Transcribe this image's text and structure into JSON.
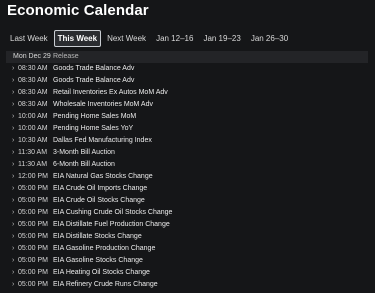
{
  "page": {
    "title": "Economic Calendar"
  },
  "tabs": [
    {
      "label": "Last Week",
      "active": false
    },
    {
      "label": "This Week",
      "active": true
    },
    {
      "label": "Next Week",
      "active": false
    },
    {
      "label": "Jan 12–16",
      "active": false
    },
    {
      "label": "Jan 19–23",
      "active": false
    },
    {
      "label": "Jan 26–30",
      "active": false
    }
  ],
  "table": {
    "header": {
      "date": "Mon Dec 29",
      "release": "Release"
    },
    "rows": [
      {
        "time": "08:30 AM",
        "release": "Goods Trade Balance Adv"
      },
      {
        "time": "08:30 AM",
        "release": "Goods Trade Balance Adv"
      },
      {
        "time": "08:30 AM",
        "release": "Retail Inventories Ex Autos MoM Adv"
      },
      {
        "time": "08:30 AM",
        "release": "Wholesale Inventories MoM Adv"
      },
      {
        "time": "10:00 AM",
        "release": "Pending Home Sales MoM"
      },
      {
        "time": "10:00 AM",
        "release": "Pending Home Sales YoY"
      },
      {
        "time": "10:30 AM",
        "release": "Dallas Fed Manufacturing Index"
      },
      {
        "time": "11:30 AM",
        "release": "3-Month Bill Auction"
      },
      {
        "time": "11:30 AM",
        "release": "6-Month Bill Auction"
      },
      {
        "time": "12:00 PM",
        "release": "EIA Natural Gas Stocks Change"
      },
      {
        "time": "05:00 PM",
        "release": "EIA Crude Oil Imports Change"
      },
      {
        "time": "05:00 PM",
        "release": "EIA Crude Oil Stocks Change"
      },
      {
        "time": "05:00 PM",
        "release": "EIA Cushing Crude Oil Stocks Change"
      },
      {
        "time": "05:00 PM",
        "release": "EIA Distillate Fuel Production Change"
      },
      {
        "time": "05:00 PM",
        "release": "EIA Distillate Stocks Change"
      },
      {
        "time": "05:00 PM",
        "release": "EIA Gasoline Production Change"
      },
      {
        "time": "05:00 PM",
        "release": "EIA Gasoline Stocks Change"
      },
      {
        "time": "05:00 PM",
        "release": "EIA Heating Oil Stocks Change"
      },
      {
        "time": "05:00 PM",
        "release": "EIA Refinery Crude Runs Change"
      }
    ]
  },
  "icons": {
    "row_expand": "chevron-right-icon"
  },
  "colors": {
    "background": "#151618",
    "header_background": "#232427",
    "active_tab_border": "#c9cdd2",
    "text": "#e6e6e6"
  }
}
